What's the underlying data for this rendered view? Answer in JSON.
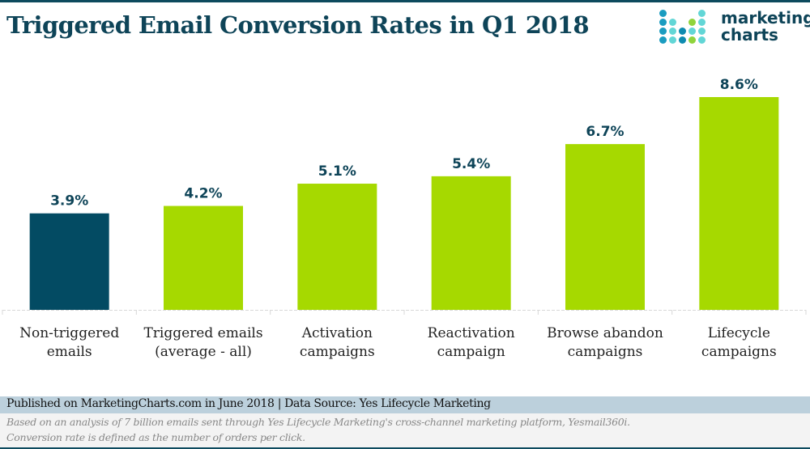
{
  "header": {
    "title": "Triggered Email Conversion Rates in Q1 2018",
    "logo_line1": "marketing",
    "logo_line2": "charts"
  },
  "colors": {
    "primary_dark": "#0e4458",
    "highlight_bar": "#034b63",
    "bar": "#a6d900",
    "source_band": "#bcd0dc",
    "notes_band": "#f3f3f3"
  },
  "chart_data": {
    "type": "bar",
    "title": "Triggered Email Conversion Rates in Q1 2018",
    "xlabel": "",
    "ylabel": "",
    "ylim": [
      0,
      9.5
    ],
    "grid": false,
    "categories": [
      [
        "Non-triggered",
        "emails"
      ],
      [
        "Triggered emails",
        "(average - all)"
      ],
      [
        "Activation",
        "campaigns"
      ],
      [
        "Reactivation",
        "campaign"
      ],
      [
        "Browse abandon",
        "campaigns"
      ],
      [
        "Lifecycle",
        "campaigns"
      ]
    ],
    "values": [
      3.9,
      4.2,
      5.1,
      5.4,
      6.7,
      8.6
    ],
    "value_labels": [
      "3.9%",
      "4.2%",
      "5.1%",
      "5.4%",
      "6.7%",
      "8.6%"
    ],
    "unit": "%",
    "highlighted_index": 0
  },
  "footer": {
    "source": "Published on MarketingCharts.com in June 2018 | Data Source: Yes Lifecycle Marketing",
    "note1": "Based on an analysis of 7 billion emails sent through Yes Lifecycle Marketing's cross-channel marketing platform, Yesmail360i.",
    "note2": "Conversion rate is defined as the number of orders per click."
  }
}
